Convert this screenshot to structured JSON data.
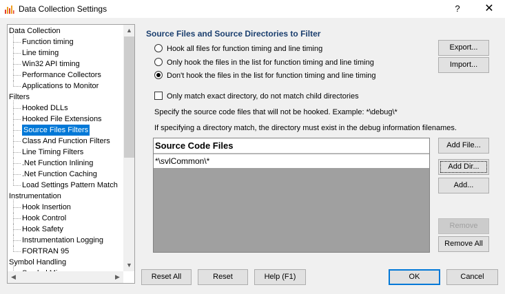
{
  "window": {
    "title": "Data Collection Settings",
    "help_glyph": "?",
    "close_glyph": "✕"
  },
  "tree": {
    "items": [
      {
        "label": "Data Collection",
        "level": 0
      },
      {
        "label": "Function timing",
        "level": 1
      },
      {
        "label": "Line timing",
        "level": 1
      },
      {
        "label": "Win32 API timing",
        "level": 1
      },
      {
        "label": "Performance Collectors",
        "level": 1
      },
      {
        "label": "Applications to Monitor",
        "level": 1
      },
      {
        "label": "Filters",
        "level": 0
      },
      {
        "label": "Hooked DLLs",
        "level": 1
      },
      {
        "label": "Hooked File Extensions",
        "level": 1
      },
      {
        "label": "Source Files Filters",
        "level": 1,
        "selected": true
      },
      {
        "label": "Class And Function Filters",
        "level": 1
      },
      {
        "label": "Line Timing Filters",
        "level": 1
      },
      {
        "label": ".Net Function Inlining",
        "level": 1
      },
      {
        "label": ".Net Function Caching",
        "level": 1
      },
      {
        "label": "Load Settings Pattern Match",
        "level": 1
      },
      {
        "label": "Instrumentation",
        "level": 0
      },
      {
        "label": "Hook Insertion",
        "level": 1
      },
      {
        "label": "Hook Control",
        "level": 1
      },
      {
        "label": "Hook Safety",
        "level": 1
      },
      {
        "label": "Instrumentation Logging",
        "level": 1
      },
      {
        "label": "FORTRAN 95",
        "level": 1
      },
      {
        "label": "Symbol Handling",
        "level": 0
      },
      {
        "label": "Symbol Misc",
        "level": 1
      }
    ],
    "arrows": {
      "up": "▲",
      "down": "▼",
      "left": "◀",
      "right": "▶"
    }
  },
  "panel": {
    "section_title": "Source Files and Source Directories to Filter",
    "radios": [
      {
        "label": "Hook all files for function timing and line timing",
        "checked": false
      },
      {
        "label": "Only hook the files in the list for function timing and line timing",
        "checked": false
      },
      {
        "label": "Don't hook the files in the list for function timing and line timing",
        "checked": true
      }
    ],
    "exact_dir_checkbox": {
      "label": "Only match exact directory, do not match child directories",
      "checked": false
    },
    "info_line_1": "Specify the source code files that will not be hooked. Example: *\\debug\\*",
    "info_line_2": "If specifying a directory match, the directory must exist in the debug information filenames.",
    "list_header": "Source Code Files",
    "list_rows": [
      "*\\svlCommon\\*"
    ]
  },
  "buttons": {
    "export": "Export...",
    "import": "Import...",
    "add_file": "Add File...",
    "add_dir": "Add Dir...",
    "add": "Add...",
    "remove": "Remove",
    "remove_all": "Remove All",
    "reset_all": "Reset All",
    "reset": "Reset",
    "help": "Help (F1)",
    "ok": "OK",
    "cancel": "Cancel"
  }
}
